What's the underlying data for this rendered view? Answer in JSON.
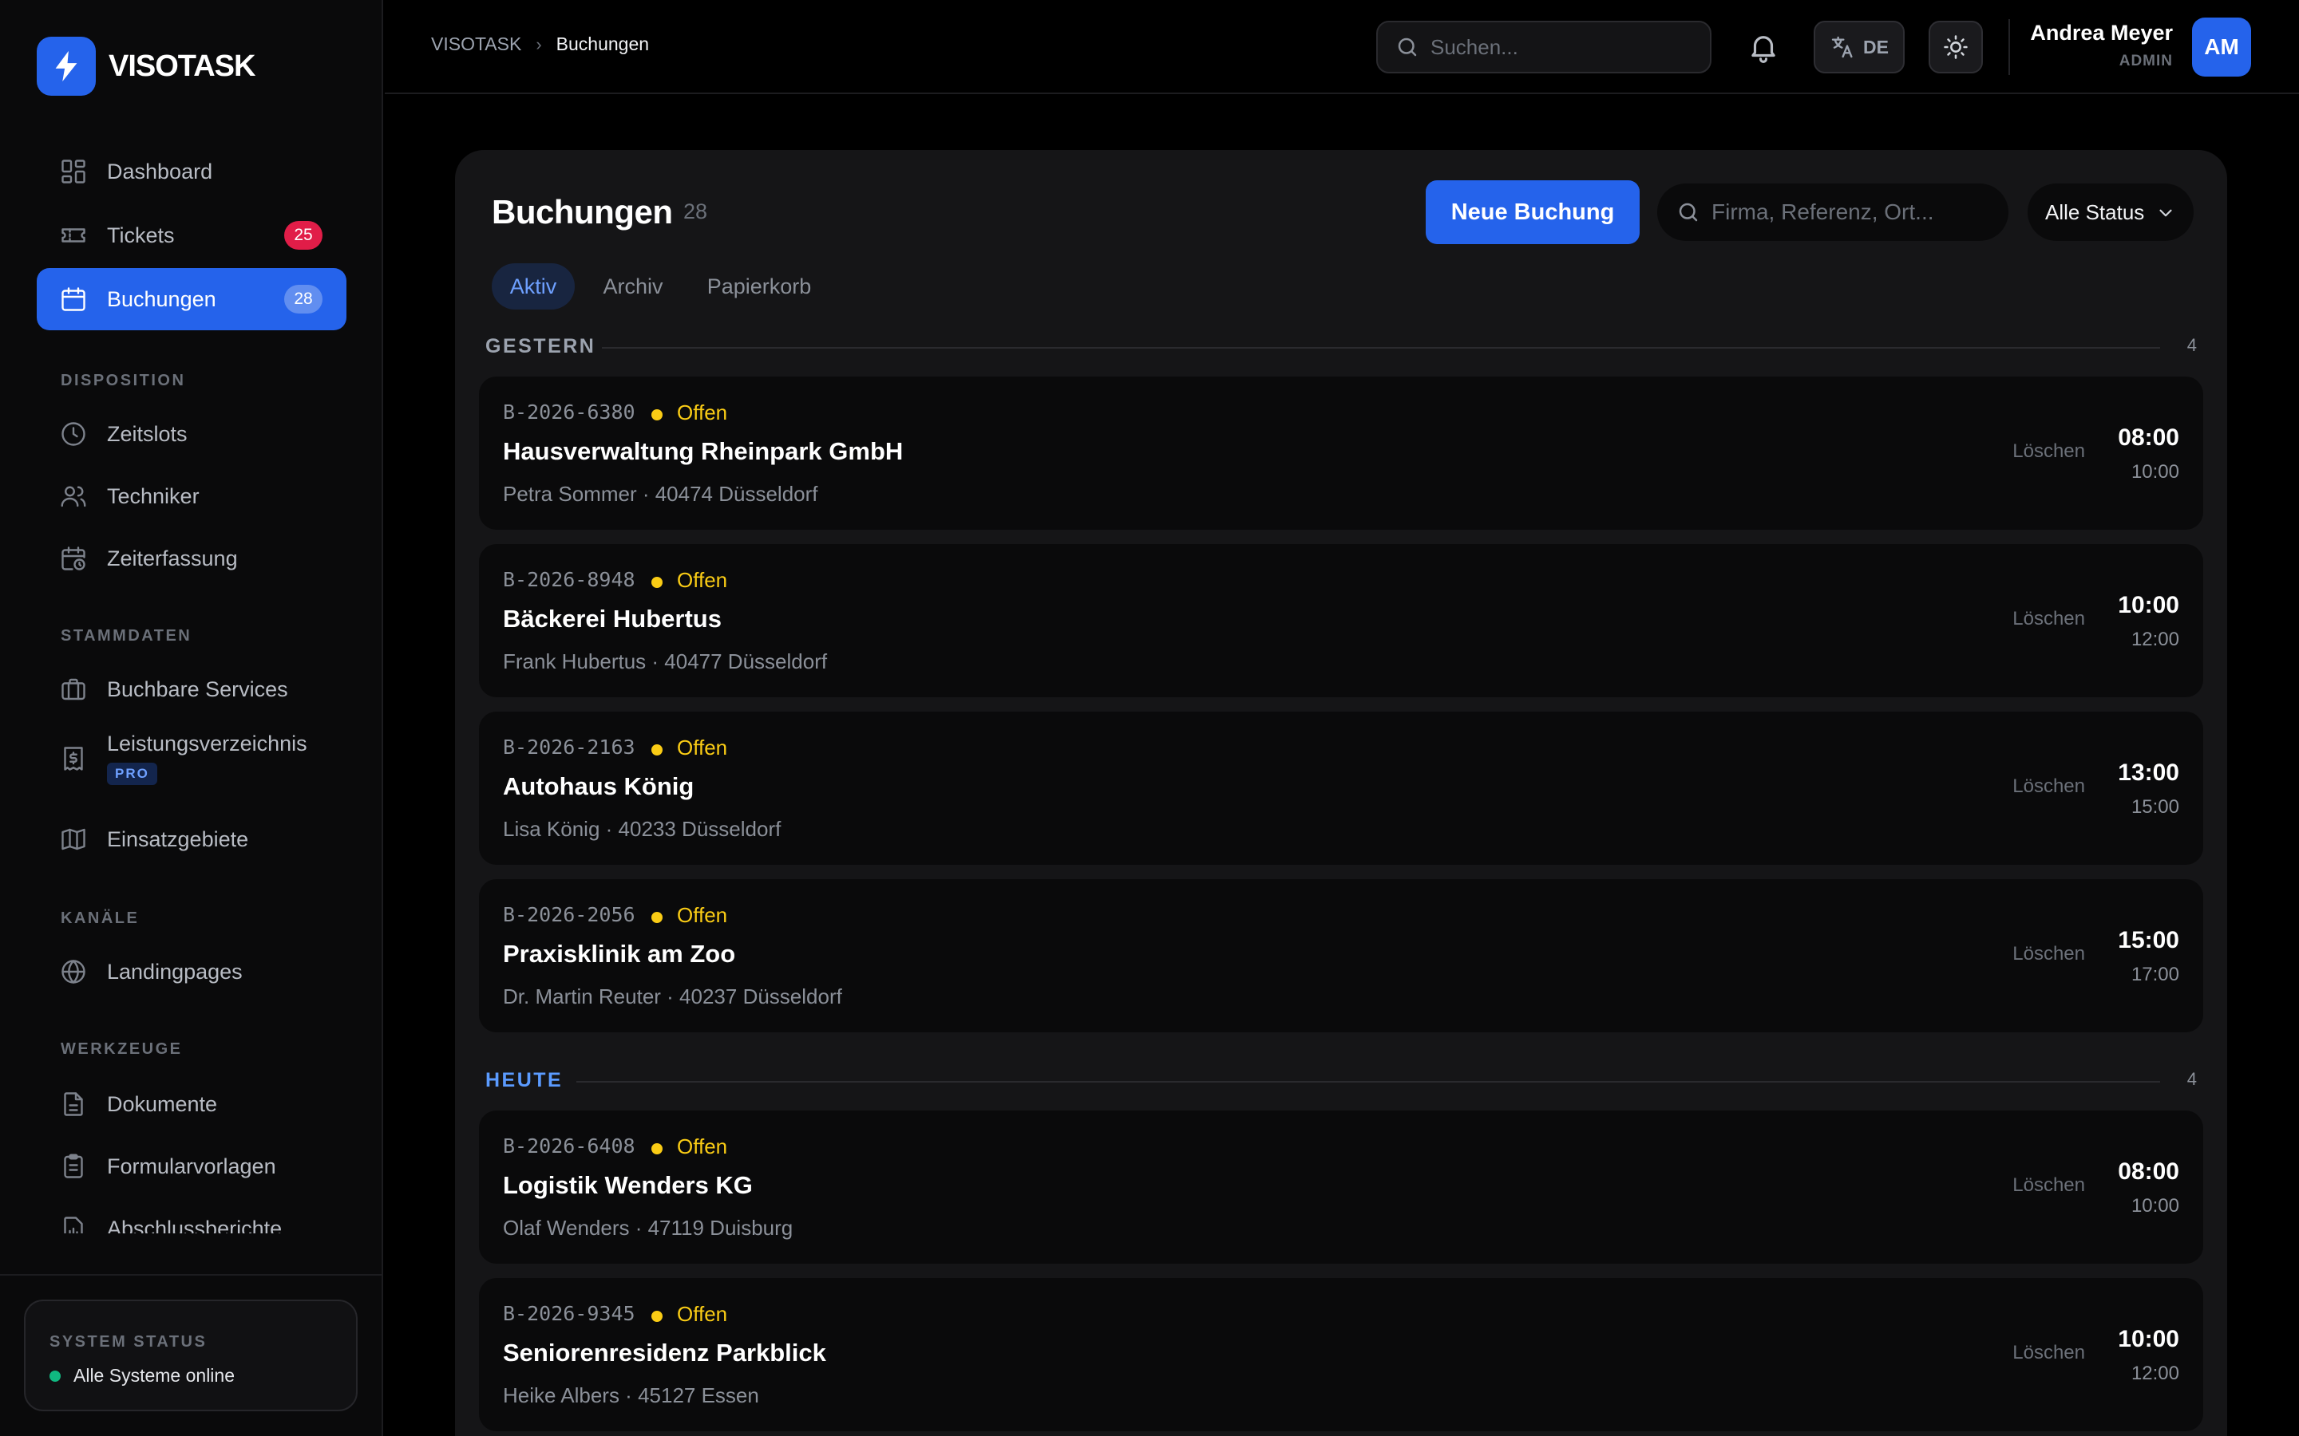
{
  "brand": {
    "name": "VISOTASK",
    "logo_icon": "lightning-bolt-icon",
    "accent": "#2563eb"
  },
  "sidebar": {
    "items": [
      {
        "label": "Dashboard",
        "icon": "dashboard-grid-icon"
      },
      {
        "label": "Tickets",
        "icon": "ticket-icon",
        "badge": "25"
      },
      {
        "label": "Buchungen",
        "icon": "calendar-icon",
        "badge": "28",
        "active": true
      }
    ],
    "sections": [
      {
        "title": "DISPOSITION",
        "items": [
          {
            "label": "Zeitslots",
            "icon": "clock-icon"
          },
          {
            "label": "Techniker",
            "icon": "users-icon"
          },
          {
            "label": "Zeiterfassung",
            "icon": "calendar-clock-icon"
          }
        ]
      },
      {
        "title": "STAMMDATEN",
        "items": [
          {
            "label": "Buchbare Services",
            "icon": "briefcase-icon"
          },
          {
            "label": "Leistungsverzeichnis",
            "icon": "receipt-dollar-icon",
            "tag": "PRO"
          },
          {
            "label": "Einsatzgebiete",
            "icon": "map-icon"
          }
        ]
      },
      {
        "title": "KANÄLE",
        "items": [
          {
            "label": "Landingpages",
            "icon": "globe-icon"
          }
        ]
      },
      {
        "title": "WERKZEUGE",
        "items": [
          {
            "label": "Dokumente",
            "icon": "document-icon"
          },
          {
            "label": "Formularvorlagen",
            "icon": "clipboard-icon"
          },
          {
            "label": "Abschlussberichte",
            "icon": "report-icon"
          }
        ]
      }
    ],
    "system_status": {
      "title": "SYSTEM STATUS",
      "text": "Alle Systeme online",
      "color": "#10b981"
    }
  },
  "topbar": {
    "breadcrumb": {
      "root": "VISOTASK",
      "current": "Buchungen"
    },
    "search_placeholder": "Suchen...",
    "language": "DE",
    "user": {
      "name": "Andrea Meyer",
      "role": "ADMIN",
      "initials": "AM"
    }
  },
  "main": {
    "title": "Buchungen",
    "count": "28",
    "new_button": "Neue Buchung",
    "search_placeholder": "Firma, Referenz, Ort...",
    "status_filter": "Alle Status",
    "tabs": [
      {
        "label": "Aktiv",
        "active": true
      },
      {
        "label": "Archiv"
      },
      {
        "label": "Papierkorb"
      }
    ],
    "groups": [
      {
        "label": "GESTERN",
        "count": "4",
        "bookings": [
          {
            "ref": "B-2026-6380",
            "status": "Offen",
            "title": "Hausverwaltung Rheinpark GmbH",
            "sub": "Petra Sommer · 40474 Düsseldorf",
            "delete": "Löschen",
            "start": "08:00",
            "end": "10:00"
          },
          {
            "ref": "B-2026-8948",
            "status": "Offen",
            "title": "Bäckerei Hubertus",
            "sub": "Frank Hubertus · 40477 Düsseldorf",
            "delete": "Löschen",
            "start": "10:00",
            "end": "12:00"
          },
          {
            "ref": "B-2026-2163",
            "status": "Offen",
            "title": "Autohaus König",
            "sub": "Lisa König · 40233 Düsseldorf",
            "delete": "Löschen",
            "start": "13:00",
            "end": "15:00"
          },
          {
            "ref": "B-2026-2056",
            "status": "Offen",
            "title": "Praxisklinik am Zoo",
            "sub": "Dr. Martin Reuter · 40237 Düsseldorf",
            "delete": "Löschen",
            "start": "15:00",
            "end": "17:00"
          }
        ]
      },
      {
        "label": "HEUTE",
        "count": "4",
        "bookings": [
          {
            "ref": "B-2026-6408",
            "status": "Offen",
            "title": "Logistik Wenders KG",
            "sub": "Olaf Wenders · 47119 Duisburg",
            "delete": "Löschen",
            "start": "08:00",
            "end": "10:00"
          },
          {
            "ref": "B-2026-9345",
            "status": "Offen",
            "title": "Seniorenresidenz Parkblick",
            "sub": "Heike Albers · 45127 Essen",
            "delete": "Löschen",
            "start": "10:00",
            "end": "12:00"
          }
        ]
      }
    ],
    "status_color": "#facc15"
  }
}
